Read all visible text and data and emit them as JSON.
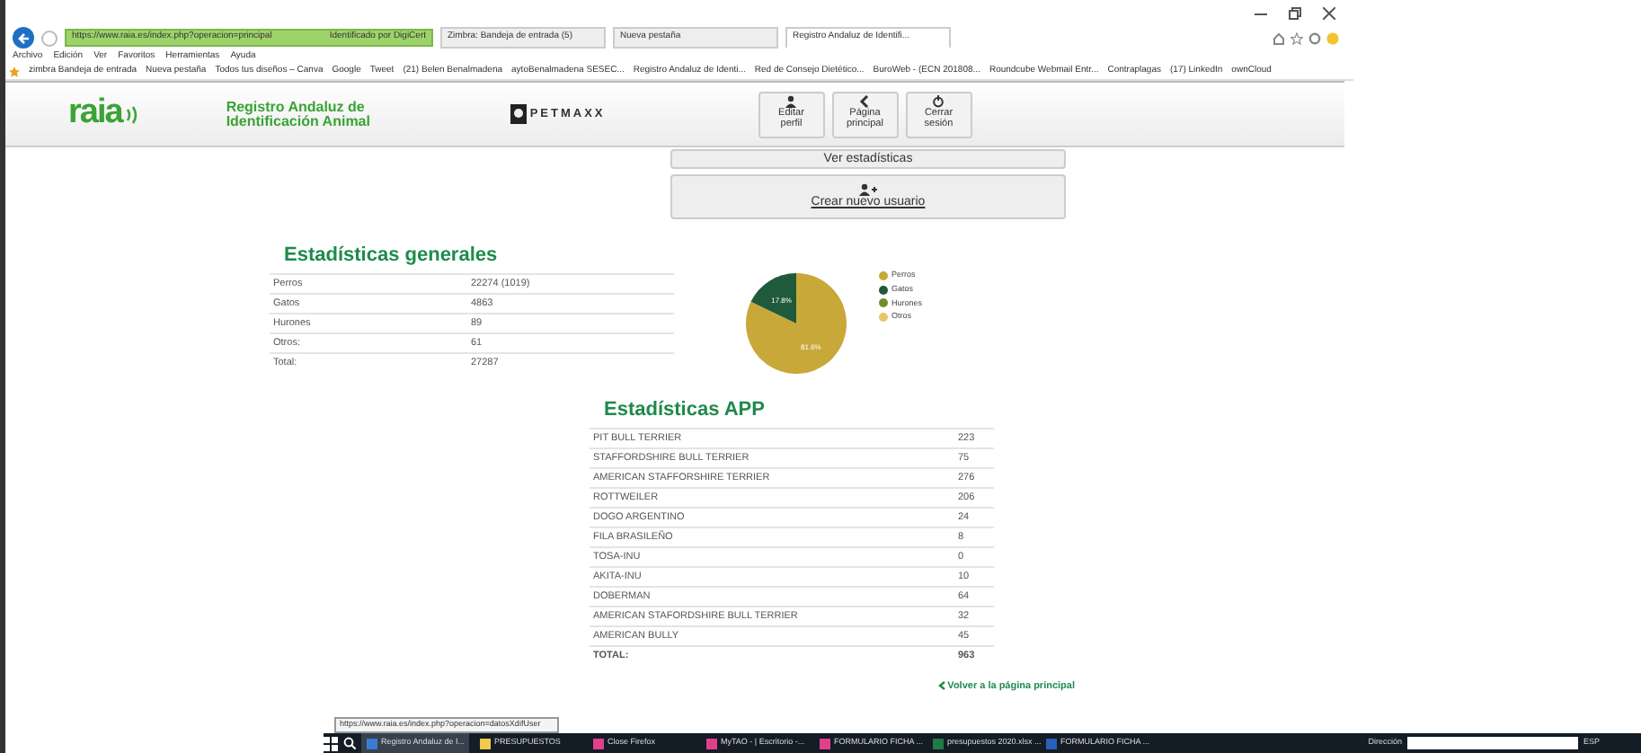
{
  "browser": {
    "address": "https://www.raia.es/index.php?operacion=principal",
    "identity": "Identificado por DigiCert",
    "tabs": [
      {
        "label": "Zimbra: Bandeja de entrada (5)",
        "selected": false
      },
      {
        "label": "Nueva pestaña",
        "selected": false
      },
      {
        "label": "Registro Andaluz de Identifi...",
        "selected": true
      }
    ],
    "menu": [
      "Archivo",
      "Edición",
      "Ver",
      "Favoritos",
      "Herramientas",
      "Ayuda"
    ],
    "favorites": [
      "zimbra Bandeja de entrada",
      "Nueva pestaña",
      "Todos tus diseños – Canva",
      "Google",
      "Tweet",
      "(21) Belen Benalmadena",
      "aytoBenalmadena SESEC...",
      "Registro Andaluz de Identi...",
      "Red de Consejo Dietético...",
      "BuroWeb - (ECN 201808...",
      "Roundcube Webmail Entr...",
      "Contraplagas",
      "(17) LinkedIn",
      "ownCloud"
    ]
  },
  "header": {
    "logo": "raia",
    "title": "Registro Andaluz de Identificación Animal",
    "partner_logo": "PETMAXX",
    "buttons": [
      {
        "kind": "user",
        "label": "Editar perfil"
      },
      {
        "kind": "back",
        "label": "Página principal"
      },
      {
        "kind": "power",
        "label": "Cerrar sesión"
      }
    ]
  },
  "actions": [
    {
      "kind": "plain",
      "label": "Ver estadísticas"
    },
    {
      "kind": "adduser",
      "label": "Crear nuevo usuario"
    }
  ],
  "general": {
    "title": "Estadísticas generales",
    "rows": [
      {
        "label": "Perros",
        "value": "22274 (1019)"
      },
      {
        "label": "Gatos",
        "value": "4863"
      },
      {
        "label": "Hurones",
        "value": "89"
      },
      {
        "label": "Otros:",
        "value": "61"
      },
      {
        "label": "Total:",
        "value": "27287"
      }
    ],
    "chart_data": {
      "type": "pie",
      "categories": [
        "Perros",
        "Gatos",
        "Hurones",
        "Otros"
      ],
      "series": [
        {
          "values": [
            81.6,
            17.8,
            null,
            null
          ]
        }
      ],
      "legend": "right",
      "colors": [
        "#c9a83a",
        "#1f5a3a",
        "#6f8f2c",
        "#e9c46a"
      ],
      "value_labels": [
        "81.6%",
        "17.8%",
        null,
        null
      ]
    }
  },
  "app": {
    "title": "Estadísticas APP",
    "rows": [
      {
        "label": "PIT BULL TERRIER",
        "value": "223"
      },
      {
        "label": "STAFFORDSHIRE BULL TERRIER",
        "value": "75"
      },
      {
        "label": "AMERICAN STAFFORSHIRE TERRIER",
        "value": "276"
      },
      {
        "label": "ROTTWEILER",
        "value": "206"
      },
      {
        "label": "DOGO ARGENTINO",
        "value": "24"
      },
      {
        "label": "FILA BRASILEÑO",
        "value": "8"
      },
      {
        "label": "TOSA-INU",
        "value": "0"
      },
      {
        "label": "AKITA-INU",
        "value": "10"
      },
      {
        "label": "DOBERMAN",
        "value": "64"
      },
      {
        "label": "AMERICAN STAFORDSHIRE BULL TERRIER",
        "value": "32"
      },
      {
        "label": "AMERICAN BULLY",
        "value": "45"
      }
    ],
    "total": {
      "label": "TOTAL:",
      "value": "963"
    }
  },
  "back_link": "Volver a la página principal",
  "status_url": "https://www.raia.es/index.php?operacion=datosXdifUser",
  "taskbar": {
    "items": [
      {
        "label": "Registro Andaluz de I...",
        "color": "#3a7bd5",
        "active": true
      },
      {
        "label": "PRESUPUESTOS",
        "color": "#f2c94c",
        "active": false
      },
      {
        "label": "Close Firefox",
        "color": "#e0408a",
        "active": false
      },
      {
        "label": "MyTAO - | Escritorio -...",
        "color": "#e0408a",
        "active": false
      },
      {
        "label": "FORMULARIO FICHA ...",
        "color": "#e0408a",
        "active": false
      },
      {
        "label": "presupuestos 2020.xlsx ...",
        "color": "#1e7b45",
        "active": false
      },
      {
        "label": "FORMULARIO FICHA ...",
        "color": "#2b5fb8",
        "active": false
      }
    ],
    "address_label": "Dirección",
    "language": "ESP"
  }
}
